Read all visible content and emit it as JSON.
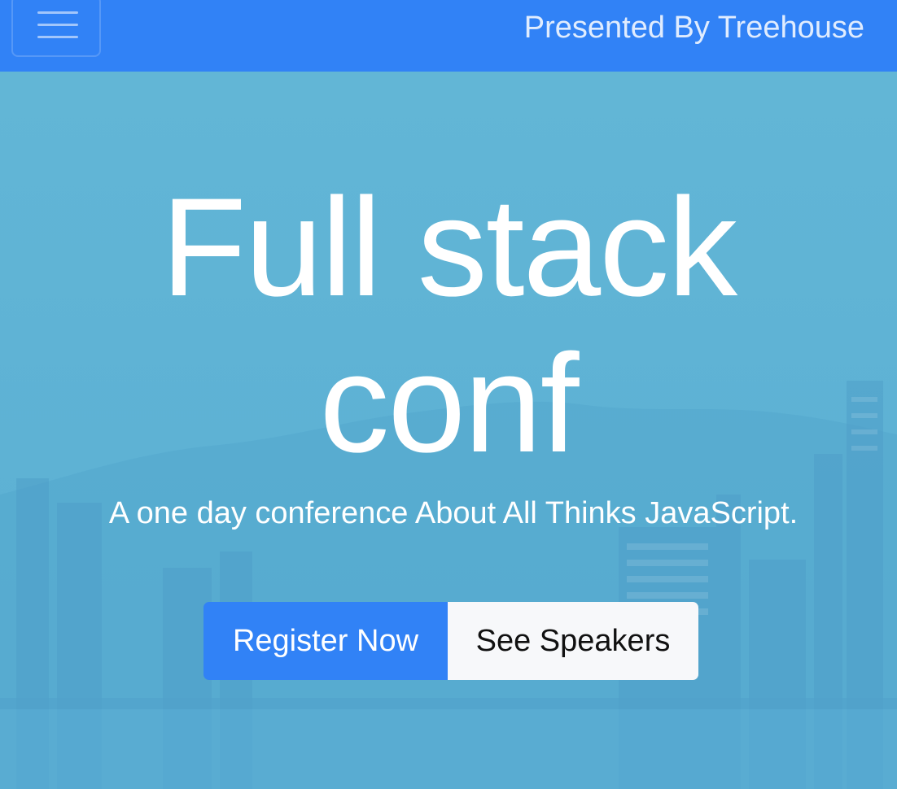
{
  "navbar": {
    "brand_text": "Presented By Treehouse",
    "toggler_icon": "hamburger-menu-icon"
  },
  "hero": {
    "title_line1": "Full stack",
    "title_line2": "conf",
    "tagline": "A one day conference About All Thinks JavaScript.",
    "primary_button_label": "Register Now",
    "secondary_button_label": "See Speakers"
  },
  "colors": {
    "navbar": "#3182f6",
    "hero_overlay": "#5fb4d5",
    "primary_button": "#3182f6",
    "secondary_button": "#f7f8fa"
  }
}
